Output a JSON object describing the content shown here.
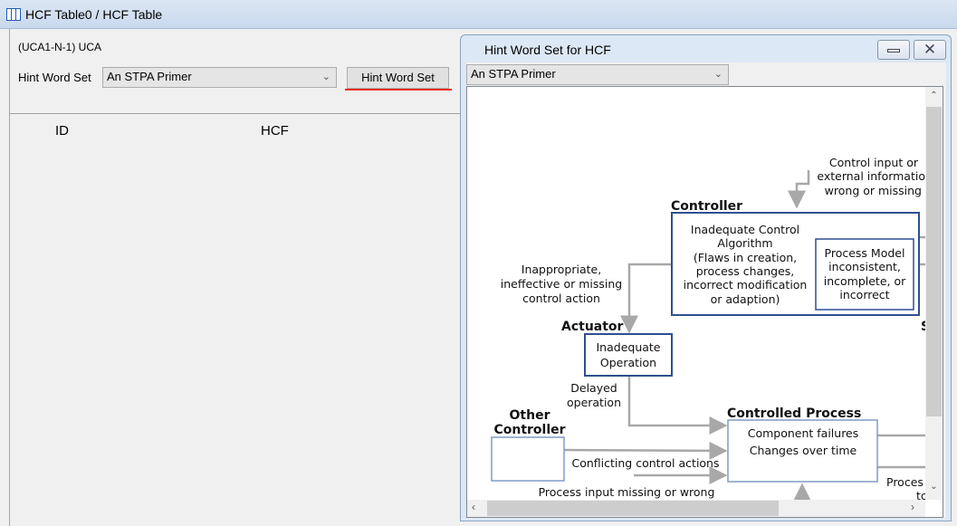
{
  "window": {
    "title": "HCF Table0 / HCF Table",
    "icon": "table-icon"
  },
  "main": {
    "uca_label": "(UCA1-N-1) UCA",
    "hint_word_set_label": "Hint Word Set",
    "hint_word_set_value": "An STPA Primer",
    "hint_word_set_button": "Hint Word Set",
    "columns": [
      "ID",
      "HCF"
    ]
  },
  "dialog": {
    "title": "Hint Word Set for HCF",
    "selected": "An STPA Primer",
    "diagram": {
      "control_input": [
        "Control input or",
        "external informatio",
        "wrong or missing"
      ],
      "controller_title": "Controller",
      "controller_text": [
        "Inadequate Control",
        "Algorithm",
        "(Flaws in creation,",
        "process changes,",
        "incorrect modification",
        "or adaption)"
      ],
      "process_model": [
        "Process Model",
        "inconsistent,",
        "incomplete, or",
        "incorrect"
      ],
      "inappropriate": [
        "Inappropriate,",
        "ineffective or missing",
        "control action"
      ],
      "actuator_title": "Actuator",
      "actuator_text": [
        "Inadequate",
        "Operation"
      ],
      "delayed": [
        "Delayed",
        "operation"
      ],
      "sensor_clip": "S",
      "other_controller": [
        "Other",
        "Controller"
      ],
      "conflicting": "Conflicting control actions",
      "process_input": "Process input missing or wrong",
      "controlled_process_title": "Controlled Process",
      "controlled_process_text": [
        "Component failures",
        "Changes over time"
      ],
      "process_clip": [
        "Proces",
        "tc"
      ]
    }
  },
  "colors": {
    "accent_underline": "#e8321e",
    "box_dark": "#2f4f8f",
    "box_light": "#7f9cc8",
    "arrow": "#a8a8a8"
  }
}
